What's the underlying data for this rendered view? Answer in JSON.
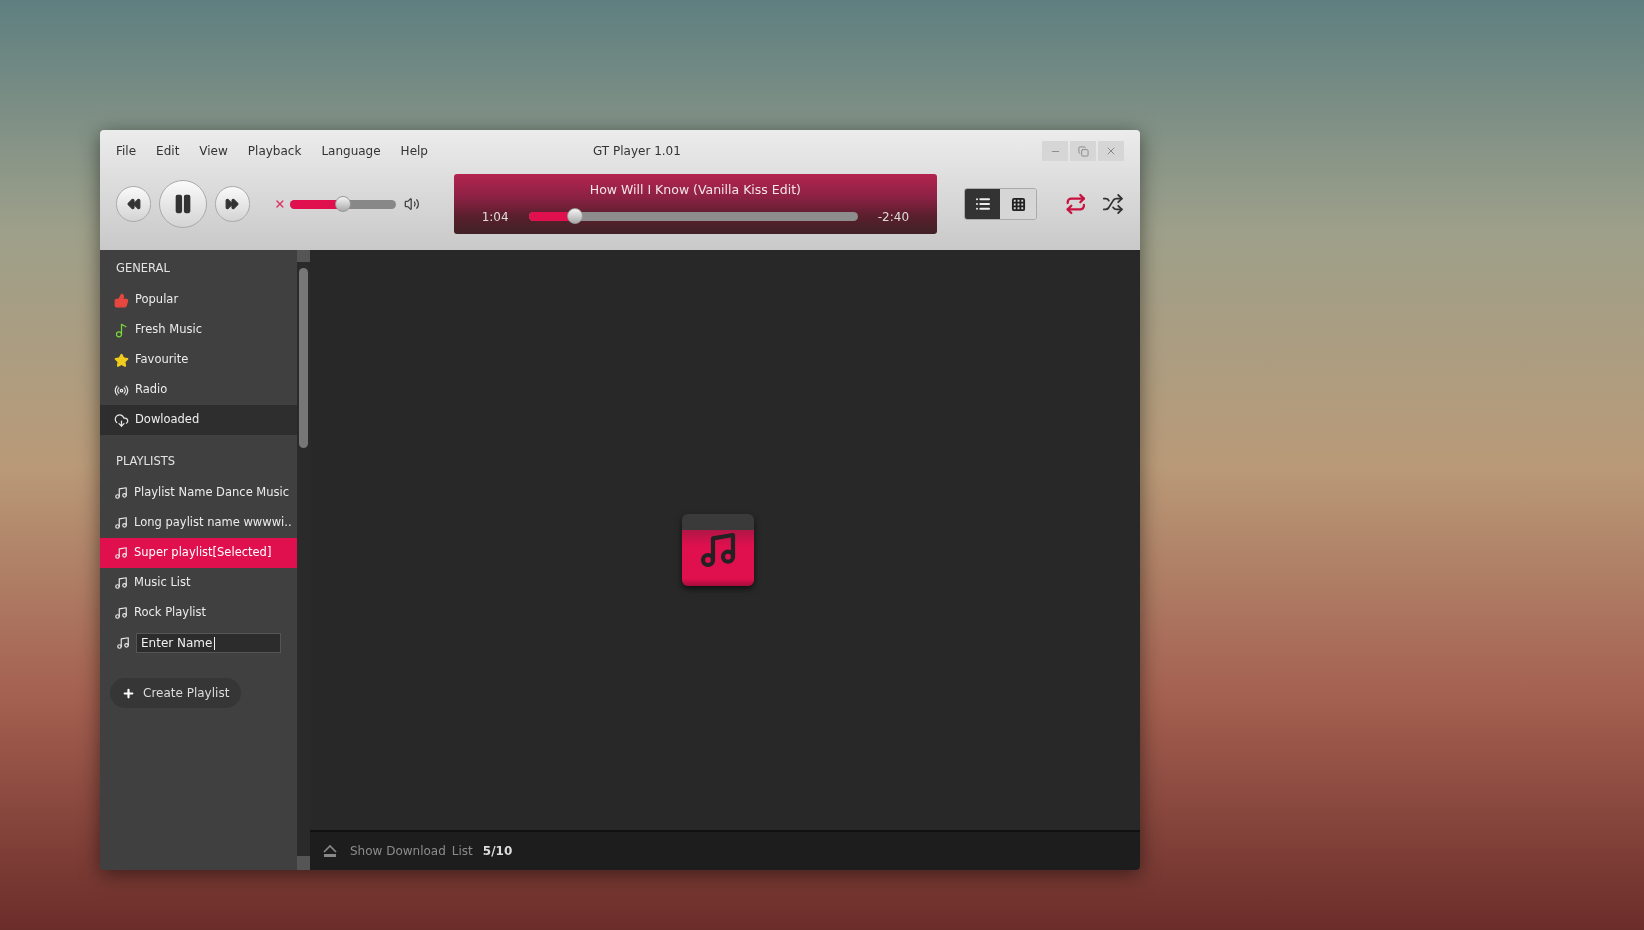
{
  "window": {
    "title": "GT Player 1.01"
  },
  "menu": [
    "File",
    "Edit",
    "View",
    "Playback",
    "Language",
    "Help"
  ],
  "volume": {
    "muted": false,
    "level": 0.5
  },
  "now_playing": {
    "title": "How Will I Know (Vanilla Kiss Edit)",
    "elapsed": "1:04",
    "remaining": "-2:40",
    "level": 0.14
  },
  "view_modes": [
    {
      "kind": "list",
      "selected": true
    },
    {
      "kind": "grid",
      "selected": false
    }
  ],
  "repeat": {
    "on": true
  },
  "shuffle": {
    "on": false
  },
  "sidebar": {
    "sections": [
      {
        "title": "GENERAL",
        "items": [
          {
            "kind": "popular",
            "label": "Popular",
            "selected": false
          },
          {
            "kind": "fresh",
            "label": "Fresh Music",
            "selected": false
          },
          {
            "kind": "favourite",
            "label": "Favourite",
            "selected": false
          },
          {
            "kind": "radio",
            "label": "Radio",
            "selected": false
          },
          {
            "kind": "downloaded",
            "label": "Dowloaded",
            "selected": true
          }
        ]
      },
      {
        "title": "PLAYLISTS",
        "items": [
          {
            "kind": "playlist",
            "label": "Playlist Name Dance Music",
            "selected": false
          },
          {
            "kind": "playlist",
            "label": "Long paylist name wwwwi..",
            "selected": false
          },
          {
            "kind": "playlist",
            "label": "Super playlist[Selected]",
            "selected": true
          },
          {
            "kind": "playlist",
            "label": "Music List",
            "selected": false
          },
          {
            "kind": "playlist",
            "label": "Rock Playlist",
            "selected": false
          }
        ]
      }
    ],
    "new_playlist": {
      "value": "Enter Name"
    },
    "create_button": "Create Playlist"
  },
  "status_bar": {
    "label": "Show Download",
    "label_2": "List",
    "count": "5/10"
  }
}
